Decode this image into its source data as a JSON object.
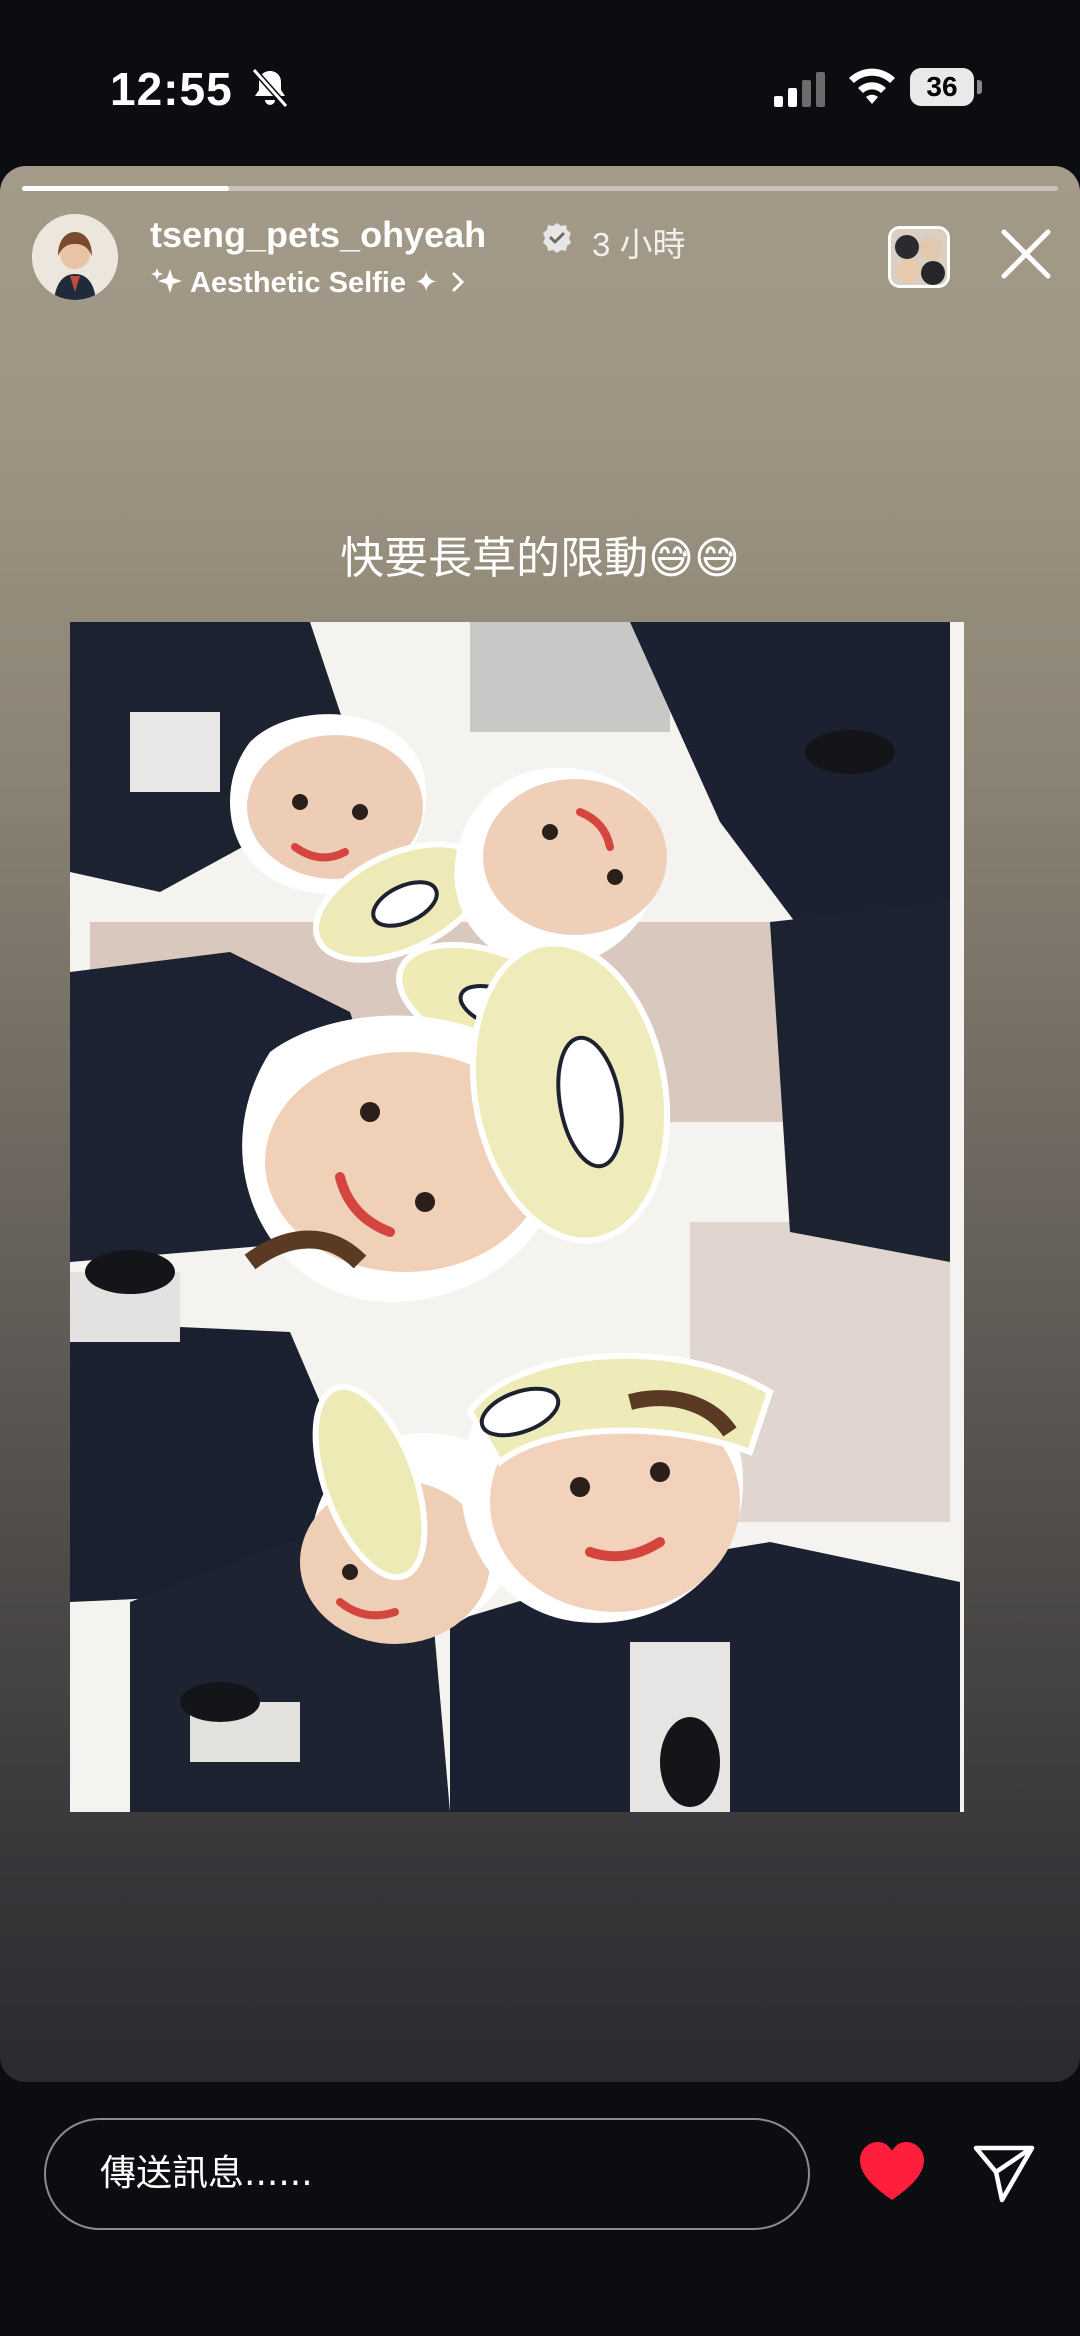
{
  "status_bar": {
    "time": "12:55",
    "battery_level": "36",
    "icons": [
      "bell-slash-icon",
      "cellular-signal-icon",
      "wifi-icon",
      "battery-icon"
    ]
  },
  "story": {
    "progress": 0.2,
    "username": "tseng_pets_ohyeah",
    "verified": true,
    "time_ago": "3 小時",
    "music_label": "Aesthetic Selfie ✦",
    "caption": "快要長草的限動😅😅",
    "close_icon": "close-icon"
  },
  "reply_bar": {
    "placeholder": "傳送訊息......",
    "like_icon": "heart-icon",
    "share_icon": "send-icon"
  },
  "colors": {
    "like": "#ff1f3d",
    "story_top": "#a49a89",
    "story_bottom": "#2b2b2f"
  }
}
